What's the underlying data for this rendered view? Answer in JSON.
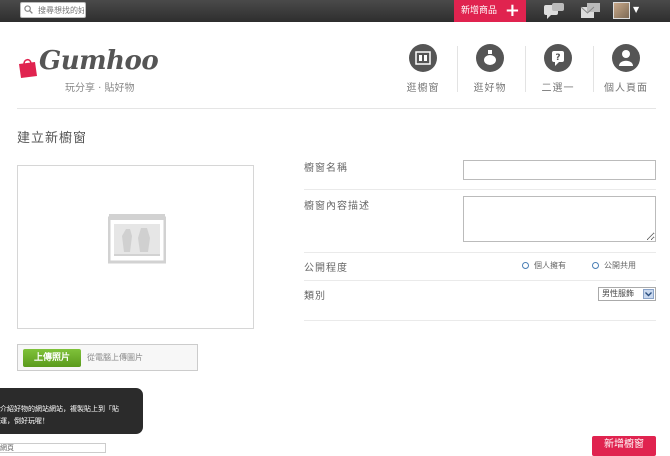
{
  "topbar": {
    "search_placeholder": "搜尋想找的好",
    "add_button_label": "新增商品",
    "add_button_icon": "plus-icon",
    "icons": [
      "search-icon",
      "chat-icon",
      "messages-icon",
      "avatar",
      "chevron-down-icon"
    ]
  },
  "brand": {
    "name": "Gumhoo",
    "tagline": "玩分享 · 貼好物",
    "accent_color": "#e0234f",
    "logo_icon": "shopping-bag-icon"
  },
  "nav": {
    "items": [
      {
        "label": "逛櫥窗",
        "icon": "storefront-icon"
      },
      {
        "label": "逛好物",
        "icon": "perfume-icon"
      },
      {
        "label": "二選一",
        "icon": "question-icon"
      },
      {
        "label": "個人頁面",
        "icon": "user-icon"
      }
    ]
  },
  "page": {
    "title": "建立新櫥窗"
  },
  "image_panel": {
    "placeholder_icon": "storefront-placeholder-icon",
    "upload_button": "上傳照片",
    "upload_hint": "從電腦上傳圖片"
  },
  "tooltip": {
    "line1": "介紹好物的網站網站，複製貼上到「貼",
    "line2": "運，倒好玩喔！"
  },
  "bottom_field": {
    "value": "網頁"
  },
  "form": {
    "name_label": "櫥窗名稱",
    "name_value": "",
    "desc_label": "櫥窗內容描述",
    "desc_value": "",
    "privacy_label": "公開程度",
    "privacy_options": [
      "個人擁有",
      "公開共用"
    ],
    "category_label": "類別",
    "category_value": "男性服飾",
    "submit_label": "新增櫥窗"
  }
}
